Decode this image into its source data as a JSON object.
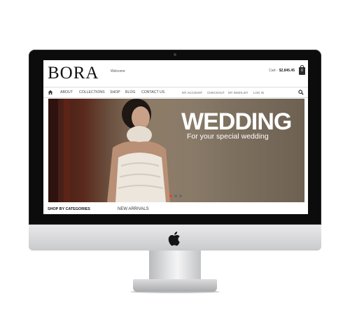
{
  "site": {
    "logo": "BORA",
    "welcome": "Welcome",
    "cart_label": "Cart -",
    "cart_total": "$2,845.45",
    "cart_count": "0"
  },
  "nav": {
    "main": [
      "ABOUT",
      "COLLECTIONS",
      "SHOP",
      "BLOG",
      "CONTACT US"
    ],
    "account": [
      "MY ACCOUNT",
      "CHECKOUT",
      "MY WISHLIST",
      "LOG IN"
    ]
  },
  "hero": {
    "title": "WEDDING",
    "subtitle": "For your special wedding",
    "active_slide": 1,
    "slide_count": 3
  },
  "sections": {
    "left": "SHOP BY CATEGORIES",
    "right": "NEW ARRIVALS"
  },
  "colors": {
    "accent": "#e8422e",
    "bezel": "#0c0c0c",
    "text": "#111111"
  },
  "icons": [
    "home-icon",
    "search-icon",
    "cart-icon",
    "apple-logo-icon"
  ]
}
